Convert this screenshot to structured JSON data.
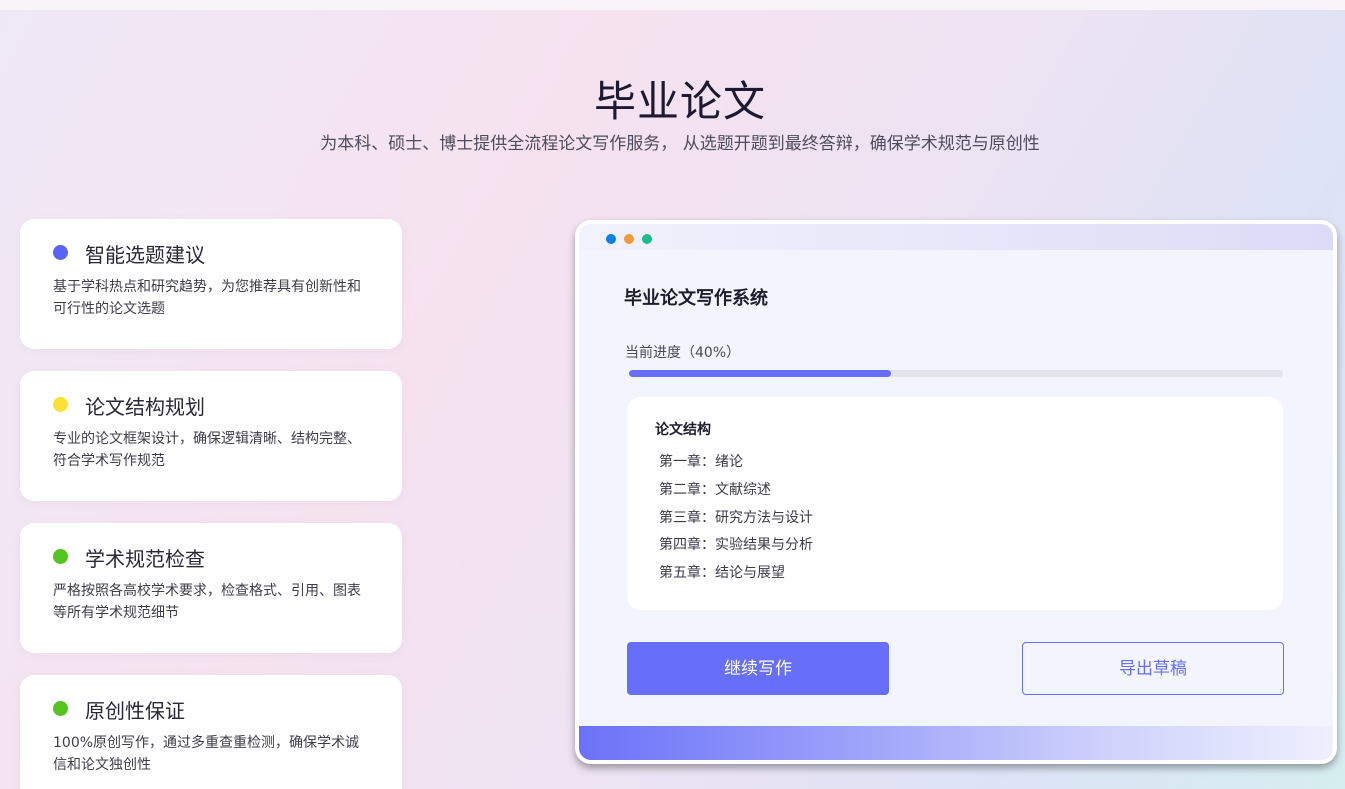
{
  "hero": {
    "title": "毕业论文",
    "subtitle": "为本科、硕士、博士提供全流程论文写作服务， 从选题开题到最终答辩，确保学术规范与原创性"
  },
  "features": [
    {
      "title": "智能选题建议",
      "desc": "基于学科热点和研究趋势，为您推荐具有创新性和可行性的论文选题",
      "dot_color": "#5b63f5"
    },
    {
      "title": "论文结构规划",
      "desc": "专业的论文框架设计，确保逻辑清晰、结构完整、符合学术写作规范",
      "dot_color": "#fbe232"
    },
    {
      "title": "学术规范检查",
      "desc": "严格按照各高校学术要求，检查格式、引用、图表等所有学术规范细节",
      "dot_color": "#56c41f"
    },
    {
      "title": "原创性保证",
      "desc": "100%原创写作，通过多重查重检测，确保学术诚信和论文独创性",
      "dot_color": "#56c41f"
    }
  ],
  "window": {
    "title": "毕业论文写作系统",
    "traffic_light_colors": [
      "#0d7fe8",
      "#f29a38",
      "#1abc8c"
    ],
    "progress": {
      "label": "当前进度（40%）",
      "value": 0.4,
      "color": "#676ef7"
    },
    "structure": {
      "title": "论文结构",
      "chapters": [
        "第一章：绪论",
        "第二章：文献综述",
        "第三章：研究方法与设计",
        "第四章：实验结果与分析",
        "第五章：结论与展望"
      ]
    },
    "buttons": {
      "continue": "继续写作",
      "export": "导出草稿"
    }
  },
  "colors": {
    "accent": "#676ef7"
  }
}
